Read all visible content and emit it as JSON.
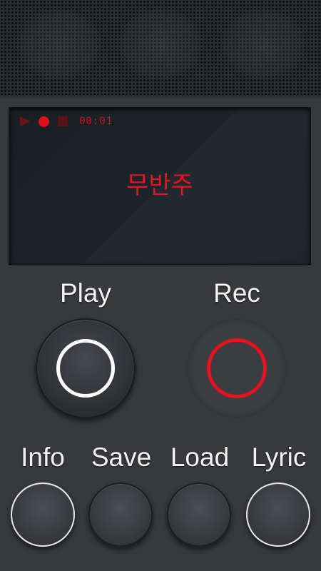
{
  "display": {
    "timer": "00:01",
    "track_title": "무반주",
    "icons": [
      "play-icon",
      "record-icon",
      "stop-icon"
    ],
    "colors": {
      "accent_red": "#e0101a",
      "dim_red": "#6e1416"
    }
  },
  "controls": {
    "play_label": "Play",
    "rec_label": "Rec"
  },
  "menu": {
    "info_label": "Info",
    "save_label": "Save",
    "load_label": "Load",
    "lyric_label": "Lyric"
  }
}
